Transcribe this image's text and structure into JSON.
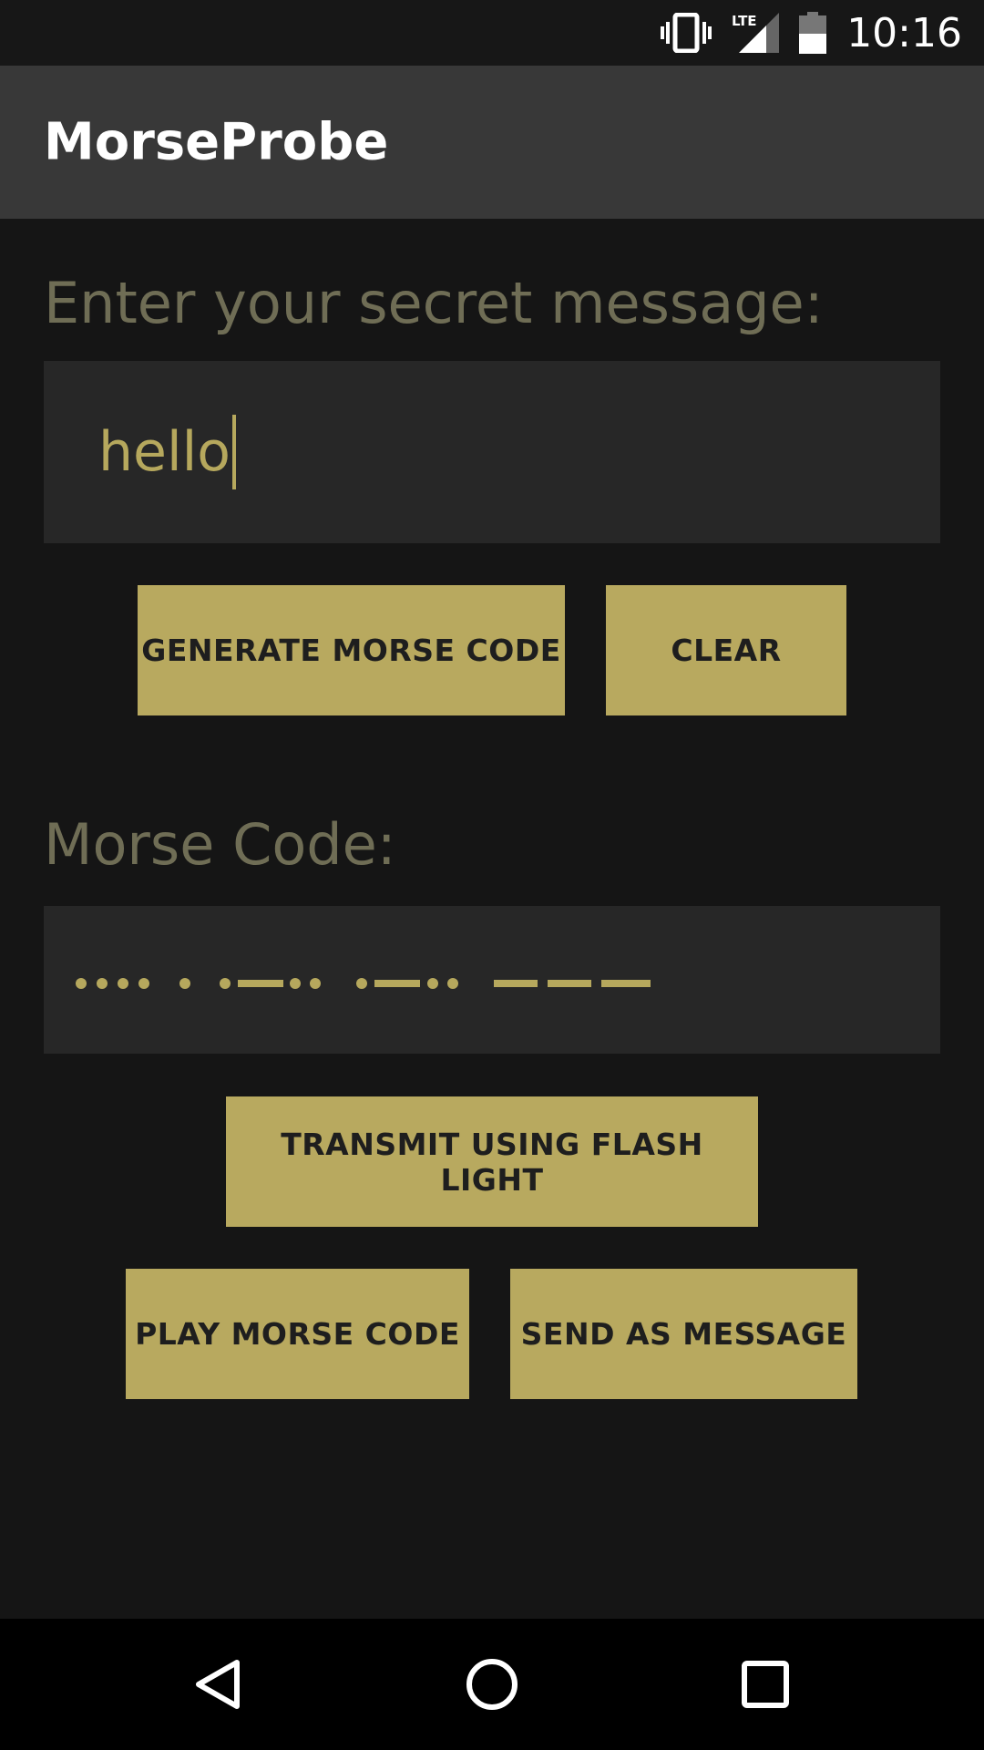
{
  "status_bar": {
    "time": "10:16",
    "icons": [
      "vibrate-icon",
      "lte-signal-icon",
      "battery-icon"
    ],
    "network_label": "LTE"
  },
  "app_bar": {
    "title": "MorseProbe"
  },
  "message_section": {
    "label": "Enter your secret message:",
    "input_value": "hello"
  },
  "buttons": {
    "generate": "GENERATE MORSE CODE",
    "clear": "CLEAR",
    "transmit": "TRANSMIT USING FLASH LIGHT",
    "play": "PLAY MORSE CODE",
    "send": "SEND AS MESSAGE"
  },
  "morse_section": {
    "label": "Morse Code:",
    "code": "•••• • •▬•• •▬•• ▬▬▬"
  },
  "nav_bar": {
    "icons": [
      "back-icon",
      "home-icon",
      "recents-icon"
    ]
  },
  "colors": {
    "accent": "#b8a95f",
    "background": "#151515",
    "app_bar": "#383838",
    "field": "#272727",
    "label": "#6f6d55"
  }
}
